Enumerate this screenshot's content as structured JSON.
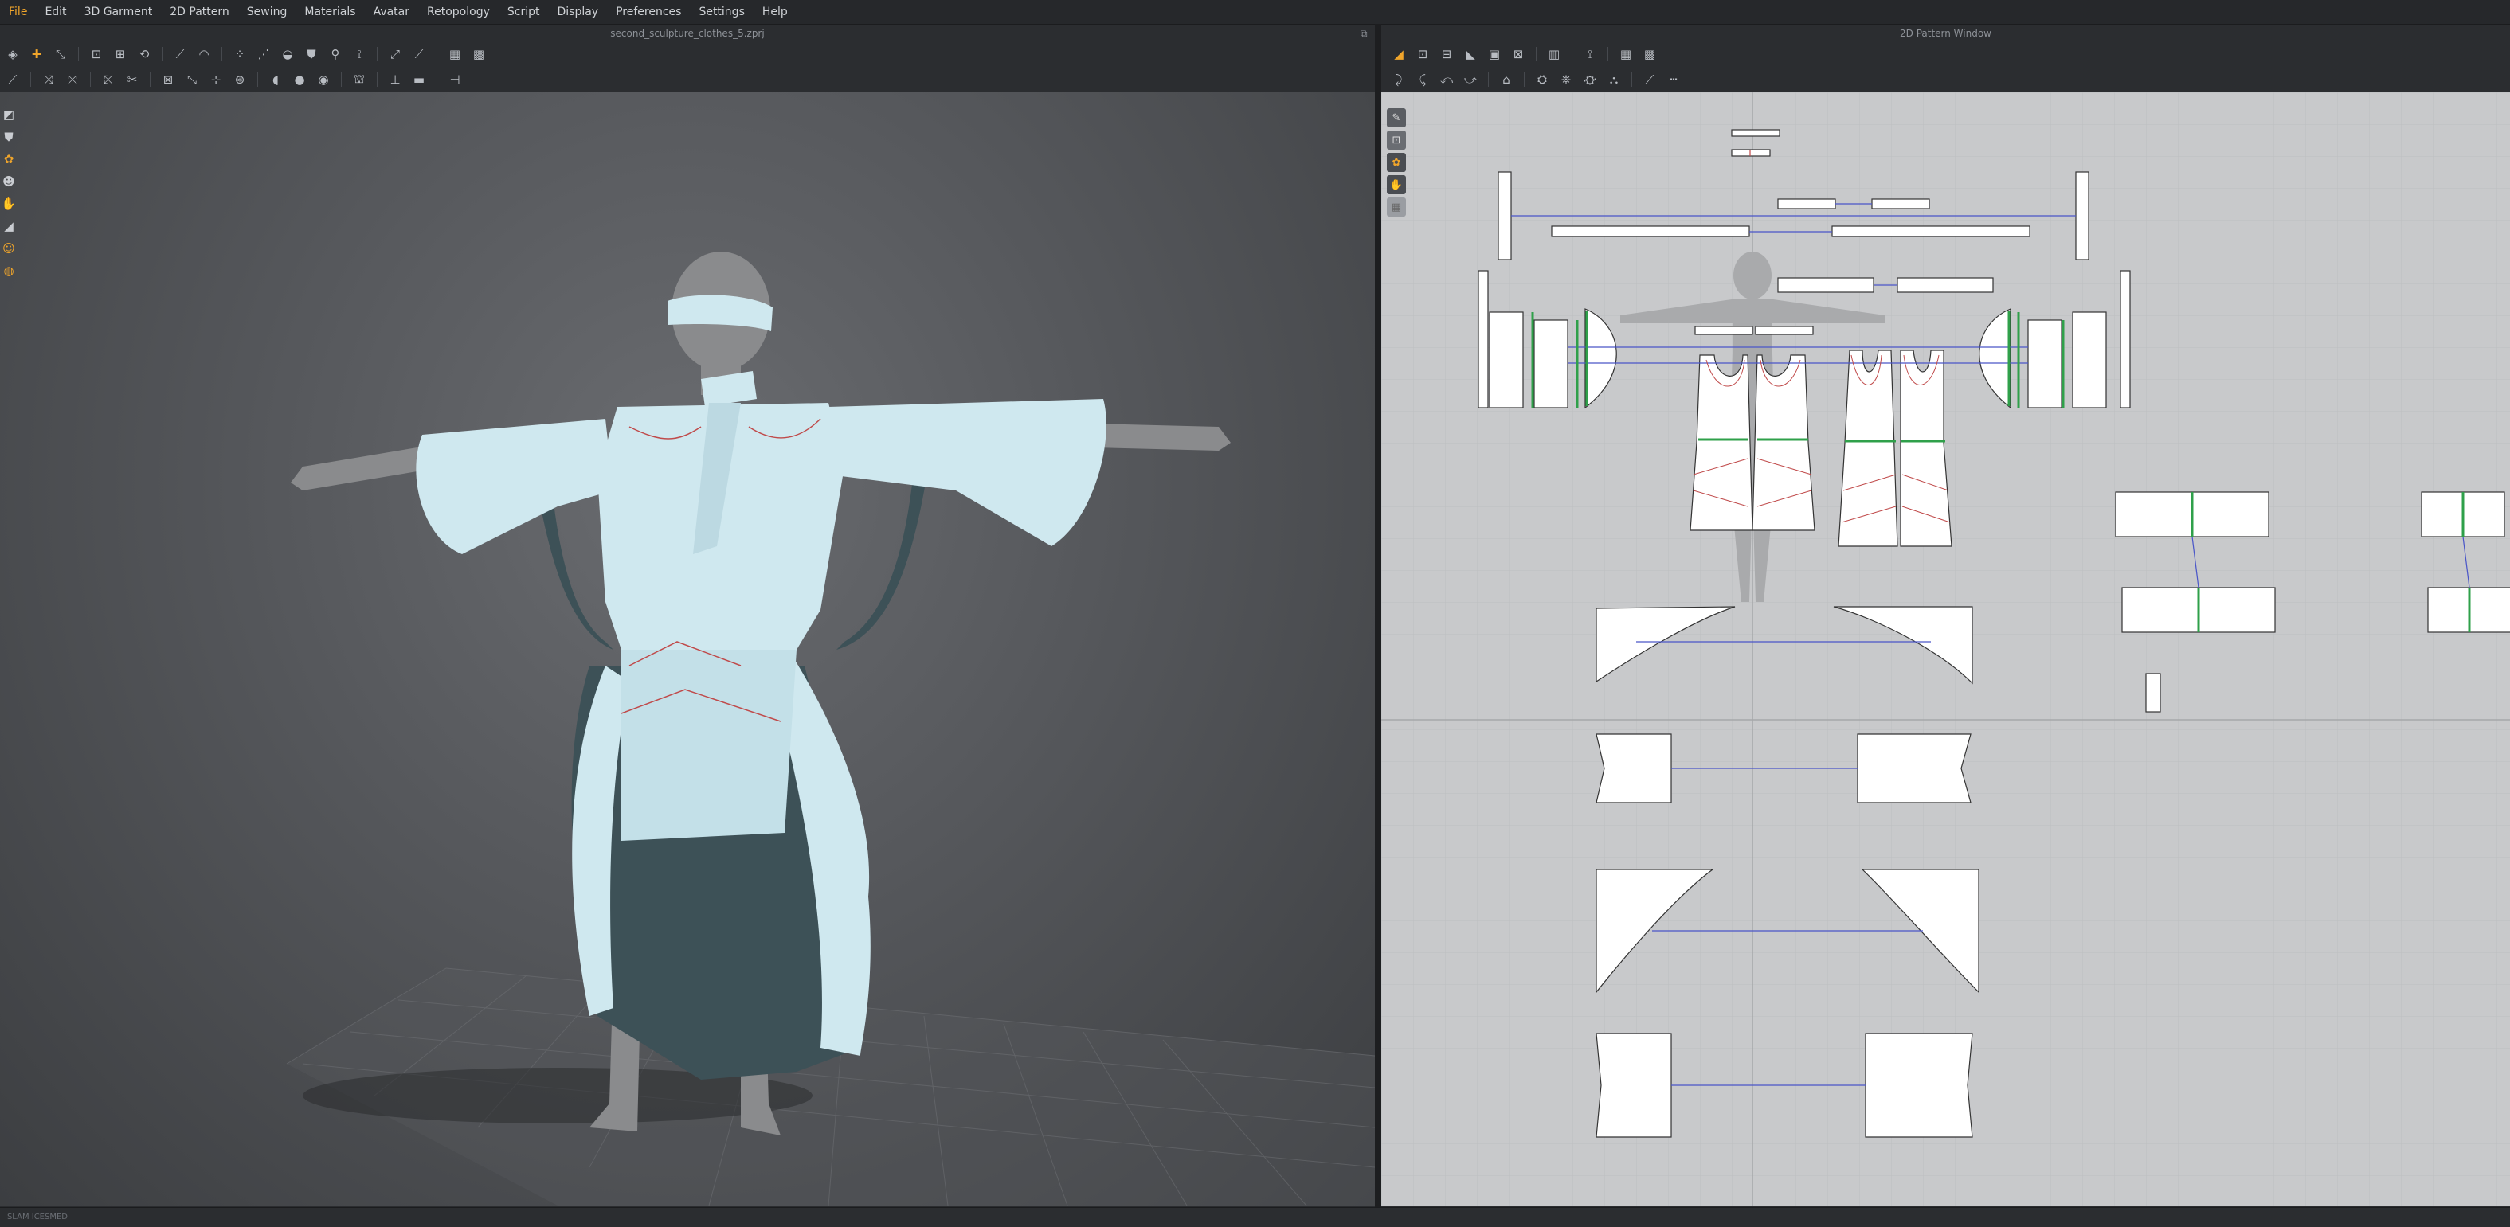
{
  "menu": {
    "items": [
      {
        "label": "File",
        "active": true
      },
      {
        "label": "Edit"
      },
      {
        "label": "3D Garment"
      },
      {
        "label": "2D Pattern"
      },
      {
        "label": "Sewing"
      },
      {
        "label": "Materials"
      },
      {
        "label": "Avatar"
      },
      {
        "label": "Retopology"
      },
      {
        "label": "Script"
      },
      {
        "label": "Display"
      },
      {
        "label": "Preferences"
      },
      {
        "label": "Settings"
      },
      {
        "label": "Help"
      }
    ],
    "active_color": "#f0a52b"
  },
  "viewport3d": {
    "title": "second_sculpture_clothes_5.zprj"
  },
  "pattern_window": {
    "title": "2D Pattern Window"
  },
  "icons": {
    "toolbar3d_row1": [
      "select-icon",
      "move-icon",
      "transform-icon",
      "fold-icon",
      "fold-arrange-icon",
      "fold-rotate-icon",
      "pin-icon",
      "tack-icon",
      "arrange-icon",
      "arrange-point-icon",
      "layer-icon",
      "shirt-icon",
      "avatar-pose-icon",
      "measure-icon",
      "tape-icon",
      "line-icon",
      "grid-icon",
      "grid-dense-icon"
    ],
    "toolbar3d_row2": [
      "brush-icon",
      "edit-curve-icon",
      "fold-line-icon",
      "cut-icon",
      "scissors-icon",
      "symmetry-icon",
      "seam-icon",
      "snap-icon",
      "texture-icon",
      "circle-icon",
      "circle-solid-icon",
      "avatar-stand-icon",
      "hanger-icon",
      "shelf-icon",
      "gizmo-icon"
    ],
    "toolbar2d_row1": [
      "polygon-icon",
      "rectangle-icon",
      "ellipse-icon",
      "dart-icon",
      "internal-icon",
      "trace-icon",
      "pleat-icon",
      "layout-icon",
      "grid-icon",
      "grid-dense-icon"
    ],
    "toolbar2d_row2": [
      "edit-pattern-icon",
      "transform-pattern-icon",
      "edit-point-icon",
      "curve-point-icon",
      "seam-line-icon",
      "tack-2d-icon",
      "sewing-icon",
      "free-sewing-icon",
      "topstitch-icon",
      "ruler-icon",
      "dashed-line-icon"
    ],
    "left3d": [
      "view-cube-icon",
      "garment-icon",
      "fabric-icon",
      "avatar-icon",
      "hand-icon",
      "flat-icon",
      "person-icon",
      "sphere-icon"
    ],
    "left2d": [
      "pen-icon",
      "select-2d-icon",
      "texture-2d-icon",
      "hand-2d-icon",
      "pattern-grid-icon"
    ]
  },
  "colors": {
    "garment": "#cfe8ef",
    "garment_shadow": "#3d5157",
    "avatar": "#8a8b8d",
    "seam_red": "#c04a4a",
    "seam_green": "#2fa04a",
    "sewing_blue": "#4a56c8"
  },
  "statusbar": {
    "text": "ISLAM ICESMED"
  }
}
